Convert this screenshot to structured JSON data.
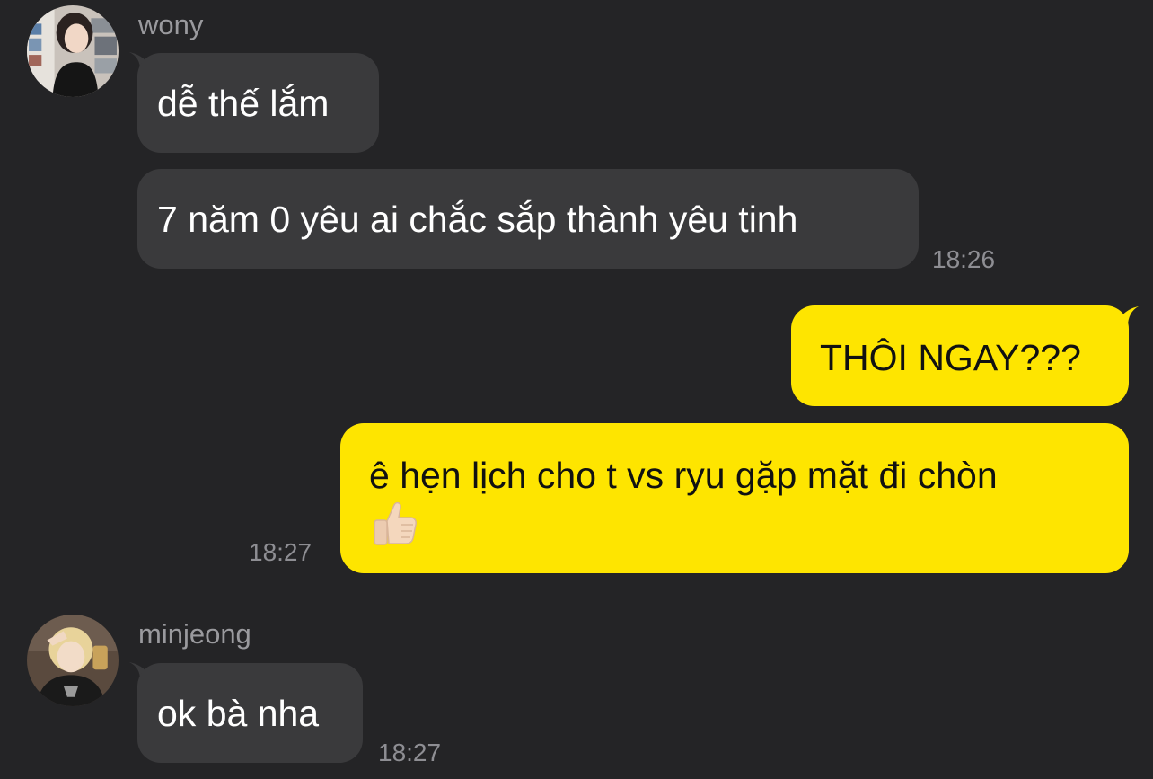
{
  "messages": [
    {
      "sender": "wony",
      "avatar": "avatar-wony",
      "bubbles": [
        "dễ thế lắm",
        "7 năm 0 yêu ai chắc sắp thành yêu tinh"
      ],
      "time": "18:26"
    },
    {
      "sender": "me",
      "bubbles": [
        "THÔI NGAY???",
        "ê hẹn lịch cho t vs ryu gặp mặt đi chòn"
      ],
      "emoji": "thumbs-up-icon",
      "time": "18:27"
    },
    {
      "sender": "minjeong",
      "avatar": "avatar-minjeong",
      "bubbles": [
        "ok bà nha"
      ],
      "time": "18:27"
    }
  ],
  "colors": {
    "background": "#242426",
    "incoming_bubble": "#3a3a3c",
    "outgoing_bubble": "#fee500",
    "name_text": "#9a9a9e",
    "time_text": "#8e8e93"
  }
}
